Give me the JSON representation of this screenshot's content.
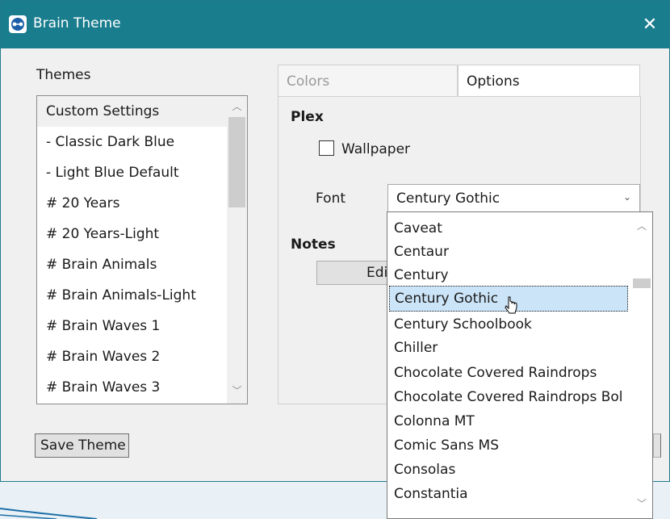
{
  "window": {
    "title": "Brain Theme",
    "close_icon": "close-icon",
    "accent_color": "#1a7d8e"
  },
  "themes": {
    "label": "Themes",
    "items": [
      "Custom Settings",
      "- Classic Dark Blue",
      "- Light Blue Default",
      "# 20 Years",
      "# 20 Years-Light",
      "# Brain Animals",
      "# Brain Animals-Light",
      "# Brain Waves 1",
      "# Brain Waves 2",
      "# Brain Waves 3"
    ],
    "selected": "Custom Settings"
  },
  "tabs": {
    "colors_label": "Colors",
    "options_label": "Options",
    "active": "Options"
  },
  "options": {
    "plex_heading": "Plex",
    "wallpaper_label": "Wallpaper",
    "wallpaper_checked": false,
    "font_label": "Font",
    "font_value": "Century Gothic",
    "notes_heading": "Notes",
    "edit_button_label": "Edit"
  },
  "font_dropdown": {
    "items": [
      "Caveat",
      "Centaur",
      "Century",
      "Century Gothic",
      "Century Schoolbook",
      "Chiller",
      "Chocolate Covered Raindrops",
      "Chocolate Covered Raindrops Bol",
      "Colonna MT",
      "Comic Sans MS",
      "Consolas",
      "Constantia"
    ],
    "highlighted": "Century Gothic",
    "highlight_color": "#cce4f7"
  },
  "footer": {
    "save_button_label": "Save Theme"
  }
}
